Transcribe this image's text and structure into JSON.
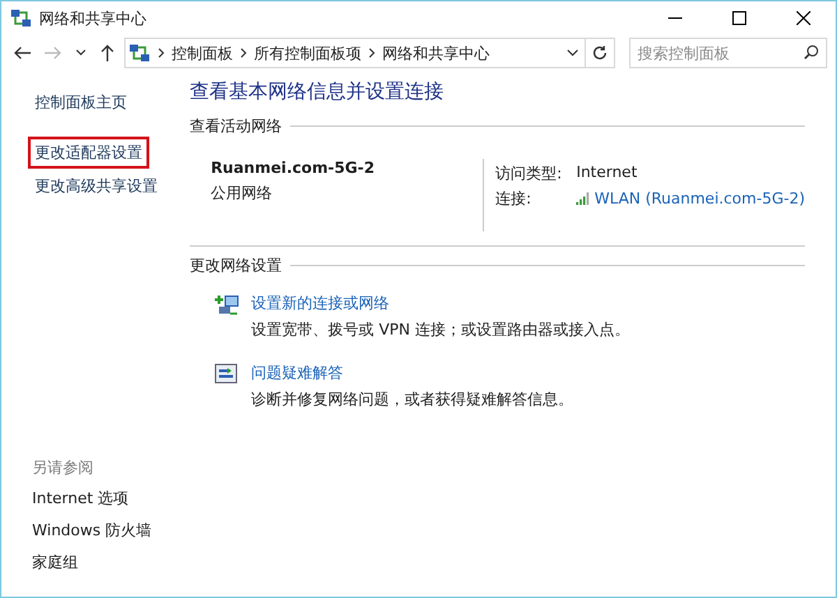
{
  "window": {
    "title": "网络和共享中心"
  },
  "address_bar": {
    "breadcrumbs": [
      "控制面板",
      "所有控制面板项",
      "网络和共享中心"
    ],
    "search": {
      "placeholder": "搜索控制面板"
    }
  },
  "sidebar": {
    "items": [
      {
        "label": "控制面板主页",
        "highlighted": false
      },
      {
        "label": "更改适配器设置",
        "highlighted": true
      },
      {
        "label": "更改高级共享设置",
        "highlighted": false
      }
    ],
    "see_also": {
      "heading": "另请参阅",
      "items": [
        "Internet 选项",
        "Windows 防火墙",
        "家庭组"
      ]
    }
  },
  "main": {
    "title": "查看基本网络信息并设置连接",
    "active_networks": {
      "heading": "查看活动网络",
      "name": "Ruanmei.com-5G-2",
      "category": "公用网络",
      "access_label": "访问类型:",
      "access_value": "Internet",
      "connection_label": "连接:",
      "connection_value": "WLAN (Ruanmei.com-5G-2)"
    },
    "change_settings": {
      "heading": "更改网络设置",
      "tasks": [
        {
          "kind": "new-connection",
          "link": "设置新的连接或网络",
          "description": "设置宽带、拨号或 VPN 连接；或设置路由器或接入点。"
        },
        {
          "kind": "troubleshoot",
          "link": "问题疑难解答",
          "description": "诊断并修复网络问题，或者获得疑难解答信息。"
        }
      ]
    }
  }
}
